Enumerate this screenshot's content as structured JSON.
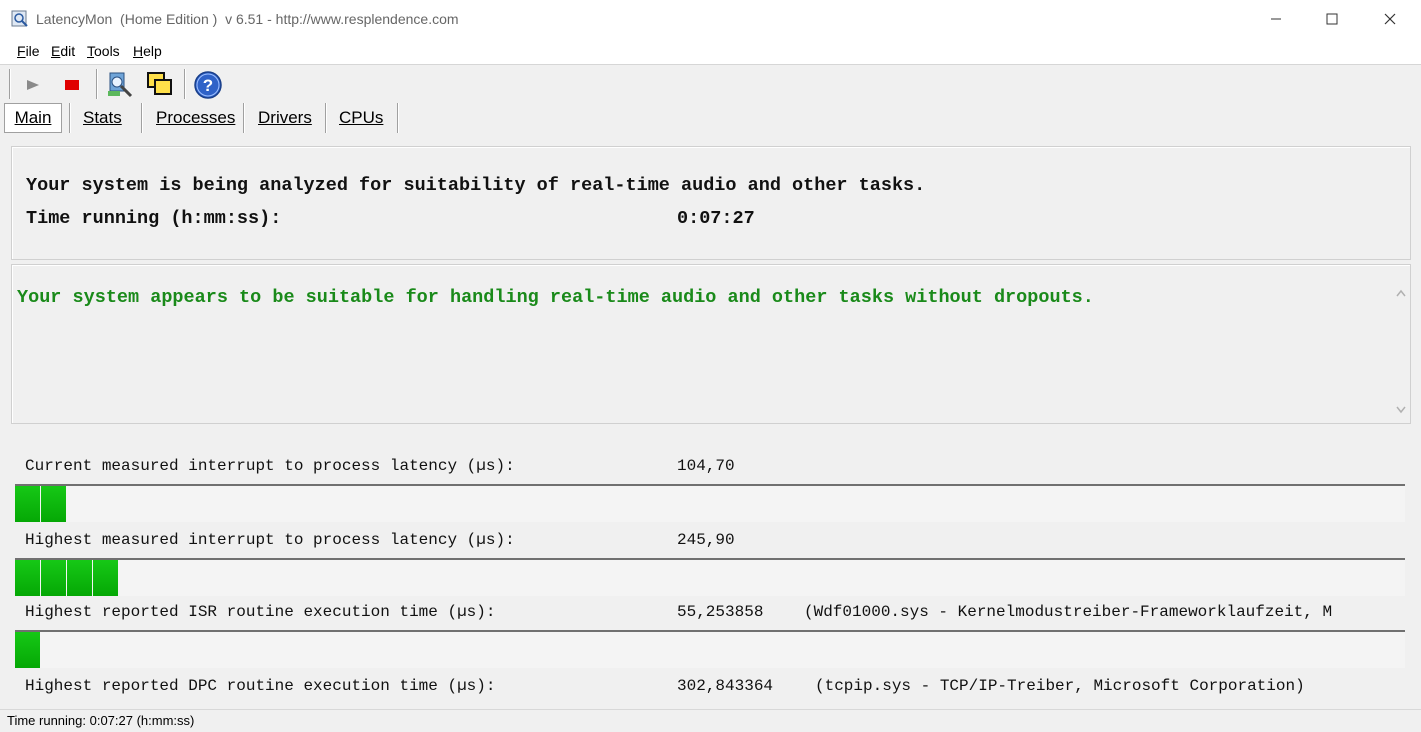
{
  "window": {
    "title": "LatencyMon  (Home Edition )  v 6.51 - http://www.resplendence.com",
    "minimize_glyph": "—",
    "maximize_glyph": "☐",
    "close_glyph": "✕"
  },
  "menu": {
    "items": [
      {
        "label": "File",
        "accelerator": "F"
      },
      {
        "label": "Edit",
        "accelerator": "E"
      },
      {
        "label": "Tools",
        "accelerator": "T"
      },
      {
        "label": "Help",
        "accelerator": "H"
      }
    ]
  },
  "toolbar": {
    "buttons": [
      {
        "icon": "play-icon",
        "color": "#8a8a8a"
      },
      {
        "icon": "stop-icon",
        "color": "#e00000"
      },
      {
        "icon": "analyze-icon"
      },
      {
        "icon": "windows-icon"
      },
      {
        "icon": "help-icon",
        "color": "#2255cc"
      }
    ]
  },
  "tabs": [
    {
      "label": "Main",
      "active": true
    },
    {
      "label": "Stats"
    },
    {
      "label": "Processes"
    },
    {
      "label": "Drivers"
    },
    {
      "label": "CPUs"
    }
  ],
  "analysis": {
    "line1": "Your system is being analyzed for suitability of real-time audio and other tasks.",
    "time_label": "Time running (h:mm:ss):",
    "time_value": "0:07:27"
  },
  "verdict": {
    "text": "Your system appears to be suitable for handling real-time audio and other tasks without dropouts.",
    "color": "#1a8a1a"
  },
  "metrics": [
    {
      "label": "Current measured interrupt to process latency (µs):",
      "value": "104,70",
      "note": "",
      "bar_segments": 2
    },
    {
      "label": "Highest measured interrupt to process latency (µs):",
      "value": "245,90",
      "note": "",
      "bar_segments": 4
    },
    {
      "label": "Highest reported ISR routine execution time (µs):",
      "value": "55,253858",
      "note": "(Wdf01000.sys - Kernelmodustreiber-Frameworklaufzeit, M",
      "bar_segments": 1
    },
    {
      "label": "Highest reported DPC routine execution time (µs):",
      "value": "302,843364",
      "note": "(tcpip.sys - TCP/IP-Treiber, Microsoft Corporation)",
      "bar_segments": 0
    }
  ],
  "status": {
    "text": "Time running: 0:07:27  (h:mm:ss)"
  }
}
